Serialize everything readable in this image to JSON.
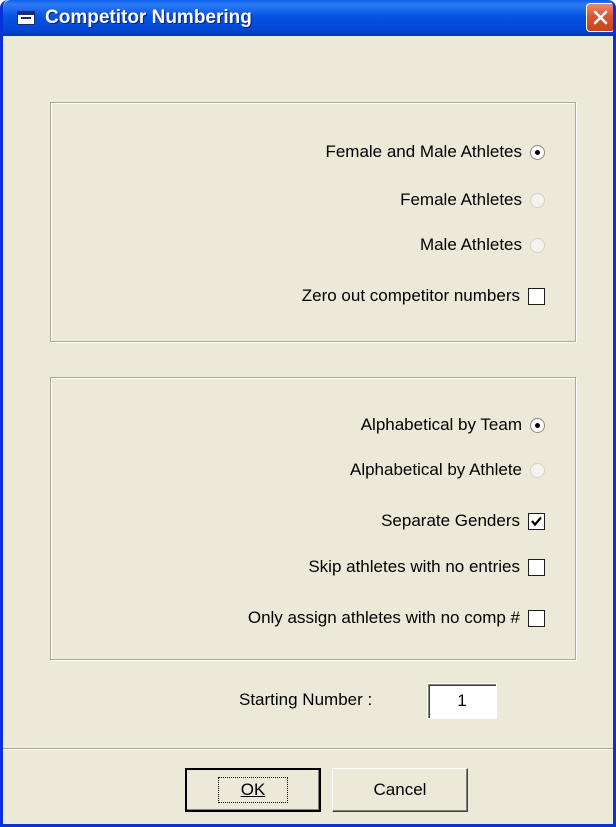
{
  "window": {
    "title": "Competitor Numbering",
    "title_icon": "window-icon",
    "close_icon": "close-icon"
  },
  "athlete_group": {
    "options": [
      {
        "label": "Female and Male Athletes",
        "selected": true
      },
      {
        "label": "Female Athletes",
        "selected": false
      },
      {
        "label": "Male Athletes",
        "selected": false
      }
    ],
    "zero_out": {
      "label": "Zero out competitor numbers",
      "checked": false
    }
  },
  "order_group": {
    "options": [
      {
        "label": "Alphabetical by Team",
        "selected": true
      },
      {
        "label": "Alphabetical by Athlete",
        "selected": false
      }
    ],
    "separate_genders": {
      "label": "Separate Genders",
      "checked": true
    },
    "skip_no_entries": {
      "label": "Skip athletes with no entries",
      "checked": false
    },
    "only_no_comp": {
      "label": "Only assign athletes with no comp #",
      "checked": false
    }
  },
  "starting_number": {
    "label": "Starting Number :",
    "value": "1"
  },
  "buttons": {
    "ok": "OK",
    "cancel": "Cancel"
  },
  "colors": {
    "titlebar": "#0A5FEA",
    "face": "#ECE9D8",
    "close": "#D9552E"
  }
}
